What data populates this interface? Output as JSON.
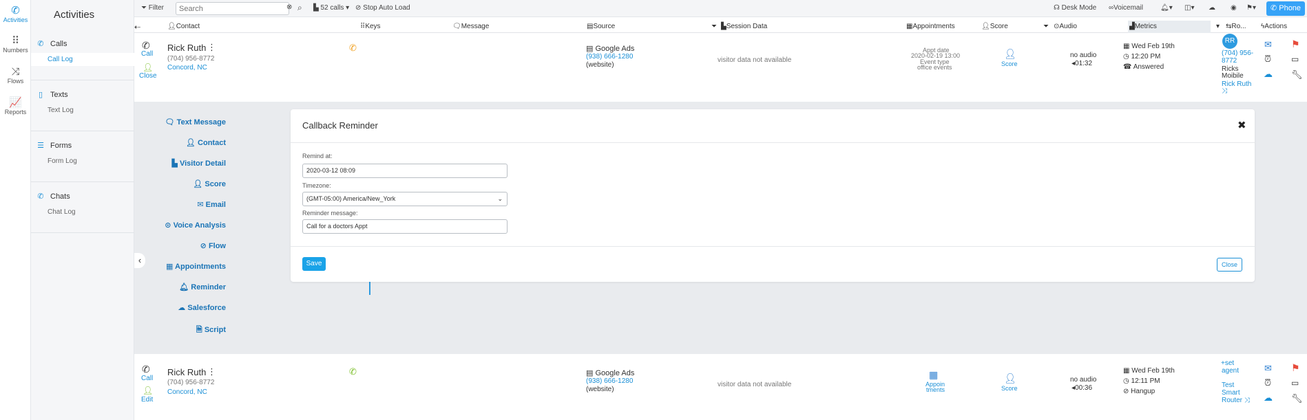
{
  "rail": {
    "activities": "Activities",
    "numbers": "Numbers",
    "flows": "Flows",
    "reports": "Reports"
  },
  "subnav": {
    "title": "Activities",
    "groups": [
      {
        "label": "Calls",
        "sub": "Call Log"
      },
      {
        "label": "Texts",
        "sub": "Text Log"
      },
      {
        "label": "Forms",
        "sub": "Form Log"
      },
      {
        "label": "Chats",
        "sub": "Chat Log"
      }
    ]
  },
  "toolbar": {
    "filter": "Filter",
    "search_placeholder": "Search",
    "calls_count": "52 calls",
    "stop_auto_load": "Stop Auto Load",
    "desk_mode": "Desk Mode",
    "voicemail": "Voicemail",
    "phone": "Phone"
  },
  "columns": {
    "contact": "Contact",
    "keys": "Keys",
    "message": "Message",
    "source": "Source",
    "session_data": "Session Data",
    "appointments": "Appointments",
    "score": "Score",
    "audio": "Audio",
    "metrics": "Metrics",
    "routing": "Ro...",
    "actions": "Actions"
  },
  "rows": [
    {
      "call_label": "Call",
      "second_action": "Close",
      "name": "Rick Ruth",
      "phone": "(704) 956-8772",
      "location": "Concord, NC",
      "source_name": "Google Ads",
      "source_number": "(938) 666-1280",
      "source_type": "(website)",
      "session": "visitor data not available",
      "appt_line1": "Appt date",
      "appt_line2": "2020-02-19 13:00",
      "appt_line3": "Event type",
      "appt_line4": "office events",
      "score": "Score",
      "audio_status": "no audio",
      "audio_duration": "01:32",
      "date": "Wed Feb 19th",
      "time": "12:20 PM",
      "status": "Answered",
      "avatar": "RR",
      "route_phone_1": "(704) 956-",
      "route_phone_2": "8772",
      "route_name_1": "Ricks",
      "route_name_2": "Moibile",
      "route_agent": "Rick Ruth"
    },
    {
      "call_label": "Call",
      "second_action": "Edit",
      "name": "Rick Ruth",
      "phone": "(704) 956-8772",
      "location": "Concord, NC",
      "source_name": "Google Ads",
      "source_number": "(938) 666-1280",
      "source_type": "(website)",
      "session": "visitor data not available",
      "appt_label_1": "Appoin",
      "appt_label_2": "tments",
      "score": "Score",
      "audio_status": "no audio",
      "audio_duration": "00:36",
      "date": "Wed Feb 19th",
      "time": "12:11 PM",
      "status": "Hangup",
      "set_agent_1": "set",
      "set_agent_2": "agent",
      "router_1": "Test",
      "router_2": "Smart",
      "router_3": "Router"
    }
  ],
  "side_menu": [
    "Text Message",
    "Contact",
    "Visitor Detail",
    "Score",
    "Email",
    "Voice Analysis",
    "Flow",
    "Appointments",
    "Reminder",
    "Salesforce",
    "Script"
  ],
  "modal": {
    "title": "Callback Reminder",
    "remind_at_label": "Remind at:",
    "remind_at_value": "2020-03-12 08:09",
    "timezone_label": "Timezone:",
    "timezone_value": "(GMT-05:00) America/New_York",
    "message_label": "Reminder message:",
    "message_value": "Call for a doctors Appt",
    "save": "Save",
    "close": "Close"
  },
  "colors": {
    "accent": "#1a8fd6",
    "phone_button": "#36a3f7",
    "flag": "#e74c3c",
    "answered_call_icon": "#f0a020",
    "hangup_call_icon": "#7cbf2a",
    "expanded_bg": "#e9ebee"
  }
}
